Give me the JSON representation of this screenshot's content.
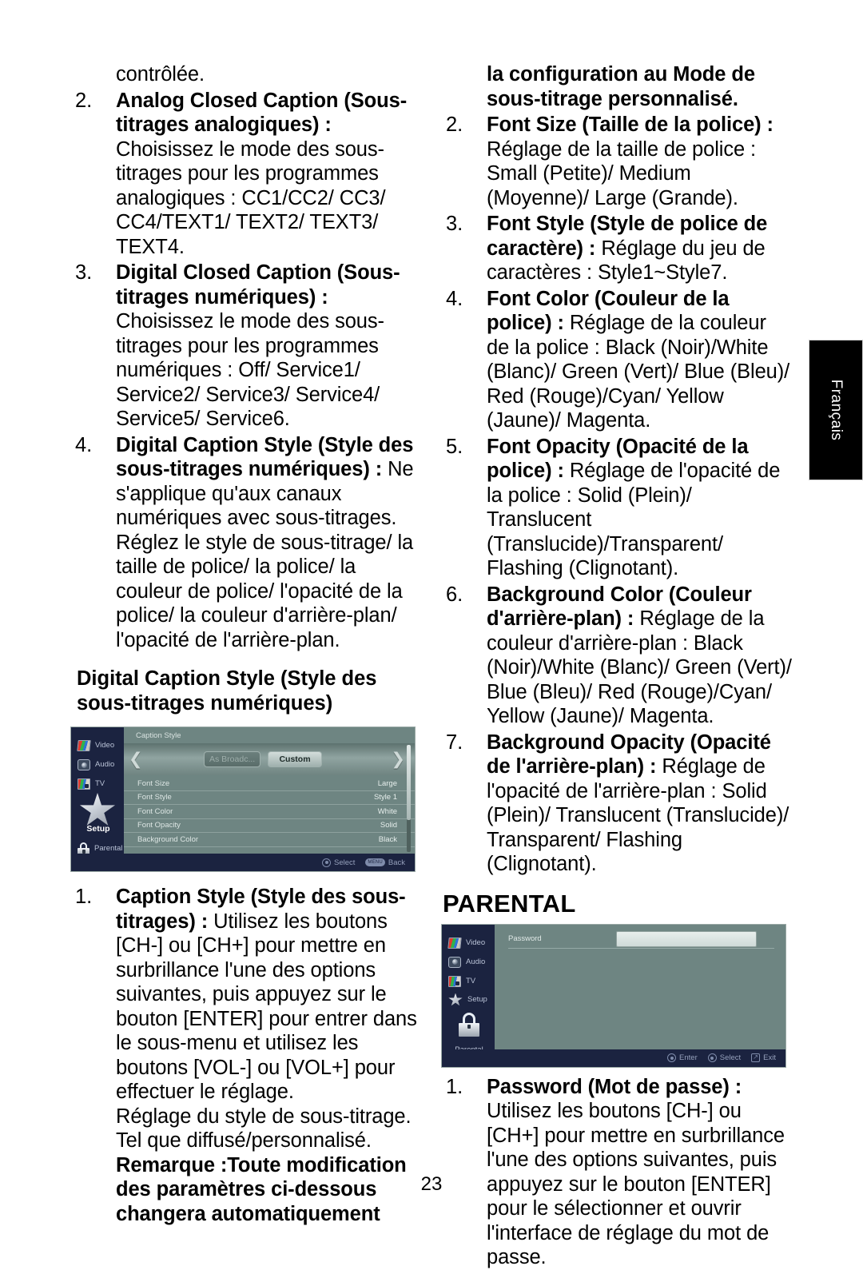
{
  "document": {
    "page_number": "23",
    "language_tab": "Français"
  },
  "left_column": {
    "continued_line": "contrôlée.",
    "items": [
      {
        "num": "2.",
        "bold": "Analog Closed Caption (Sous-titrages analogiques) :",
        "body": "Choisissez le mode des sous-titrages pour les programmes analogiques : CC1/CC2/ CC3/ CC4/TEXT1/ TEXT2/ TEXT3/ TEXT4."
      },
      {
        "num": "3.",
        "bold": "Digital Closed Caption (Sous-titrages numériques) :",
        "body": "Choisissez le mode des sous-titrages pour les programmes numériques : Off/ Service1/ Service2/ Service3/ Service4/ Service5/ Service6."
      },
      {
        "num": "4.",
        "bold": "Digital Caption Style (Style des sous-titrages numériques) :",
        "body": "Ne s'applique qu'aux canaux numériques avec sous-titrages. Réglez le style de sous-titrage/ la taille de police/ la police/ la couleur de police/ l'opacité de la police/ la couleur d'arrière-plan/ l'opacité de l'arrière-plan."
      }
    ],
    "subheading": "Digital Caption Style (Style des sous-titrages numériques)",
    "item_after_figure": {
      "num": "1.",
      "bold": "Caption Style (Style des sous-titrages) :",
      "body": "Utilisez les boutons [CH-] ou [CH+] pour mettre en surbrillance l'une des options suivantes, puis appuyez sur le bouton [ENTER] pour entrer dans le sous-menu et utilisez les boutons [VOL-] ou [VOL+] pour effectuer le réglage."
    },
    "note_lines": [
      "Réglage du style de sous-titrage.",
      "Tel que diffusé/personnalisé."
    ],
    "remark": "Remarque :Toute modification des paramètres ci-dessous changera automatiquement"
  },
  "right_column": {
    "continued_bold": "la configuration au Mode de sous-titrage personnalisé.",
    "items": [
      {
        "num": "2.",
        "bold": "Font Size (Taille de la police) :",
        "body": "Réglage de la taille de police : Small (Petite)/ Medium (Moyenne)/ Large (Grande)."
      },
      {
        "num": "3.",
        "bold": "Font Style (Style de police de caractère) :",
        "body": "Réglage du jeu de caractères : Style1~Style7."
      },
      {
        "num": "4.",
        "bold": "Font Color (Couleur de la police) :",
        "body": "Réglage de la couleur de la police : Black (Noir)/White (Blanc)/ Green (Vert)/ Blue (Bleu)/ Red (Rouge)/Cyan/ Yellow (Jaune)/ Magenta."
      },
      {
        "num": "5.",
        "bold": "Font Opacity (Opacité de la police) :",
        "body": "Réglage de l'opacité de la police : Solid (Plein)/ Translucent (Translucide)/Transparent/ Flashing (Clignotant)."
      },
      {
        "num": "6.",
        "bold": "Background Color (Couleur d'arrière-plan) :",
        "body": "Réglage de la couleur d'arrière-plan : Black (Noir)/White (Blanc)/ Green (Vert)/ Blue (Bleu)/ Red (Rouge)/Cyan/ Yellow (Jaune)/ Magenta."
      },
      {
        "num": "7.",
        "bold": "Background Opacity (Opacité de l'arrière-plan) :",
        "body": "Réglage de l'opacité de l'arrière-plan : Solid (Plein)/ Translucent (Translucide)/ Transparent/ Flashing (Clignotant)."
      }
    ],
    "section_title": "PARENTAL",
    "item_after_figure": {
      "num": "1.",
      "bold": "Password (Mot de passe) :",
      "body": "Utilisez les boutons [CH-] ou [CH+] pour mettre en surbrillance l'une des options suivantes, puis appuyez sur le bouton [ENTER] pour le sélectionner et ouvrir l'interface de réglage du mot de passe."
    }
  },
  "osd_caption_style": {
    "title": "Caption Style",
    "sidebar": [
      {
        "label": "Video",
        "icon": "video-icon"
      },
      {
        "label": "Audio",
        "icon": "audio-icon"
      },
      {
        "label": "TV",
        "icon": "tv-icon"
      },
      {
        "label": "Setup",
        "icon": "star-icon"
      },
      {
        "label": "Parental",
        "icon": "lock-icon"
      }
    ],
    "tabs": {
      "inactive": "As Broadc...",
      "active": "Custom"
    },
    "rows": [
      {
        "label": "Font Size",
        "value": "Large"
      },
      {
        "label": "Font Style",
        "value": "Style 1"
      },
      {
        "label": "Font Color",
        "value": "White"
      },
      {
        "label": "Font Opacity",
        "value": "Solid"
      },
      {
        "label": "Background Color",
        "value": "Black"
      }
    ],
    "footer": [
      {
        "key": "dpad",
        "label": "Select"
      },
      {
        "key": "MENU",
        "label": "Back"
      }
    ]
  },
  "osd_parental": {
    "sidebar": [
      {
        "label": "Video",
        "icon": "video-icon"
      },
      {
        "label": "Audio",
        "icon": "audio-icon"
      },
      {
        "label": "TV",
        "icon": "tv-icon"
      },
      {
        "label": "Setup",
        "icon": "star-icon"
      },
      {
        "label": "Parental",
        "icon": "lock-icon"
      }
    ],
    "password_label": "Password",
    "password_value": "",
    "footer": [
      {
        "key": "enter",
        "label": "Enter"
      },
      {
        "key": "dpad",
        "label": "Select"
      },
      {
        "key": "exit",
        "label": "Exit"
      }
    ]
  }
}
